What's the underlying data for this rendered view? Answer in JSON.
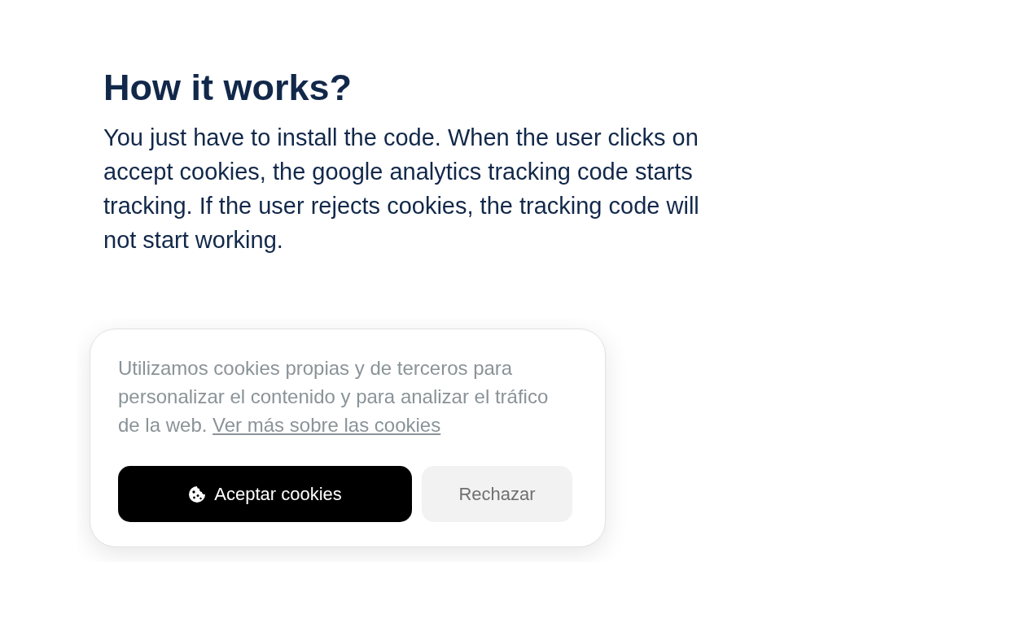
{
  "section": {
    "heading": "How it works?",
    "description": "You just have to install the code. When the user clicks on accept cookies, the google analytics tracking code starts tracking. If the user rejects cookies, the tracking code will not start working."
  },
  "cookie_banner": {
    "message": "Utilizamos cookies propias y de terceros para personalizar el contenido y para analizar el tráfico de la web.",
    "link": "Ver más sobre las cookies",
    "buttons": [
      {
        "label": "Aceptar cookies",
        "kind": "accept"
      },
      {
        "label": "Rechazar",
        "kind": "reject"
      }
    ]
  }
}
